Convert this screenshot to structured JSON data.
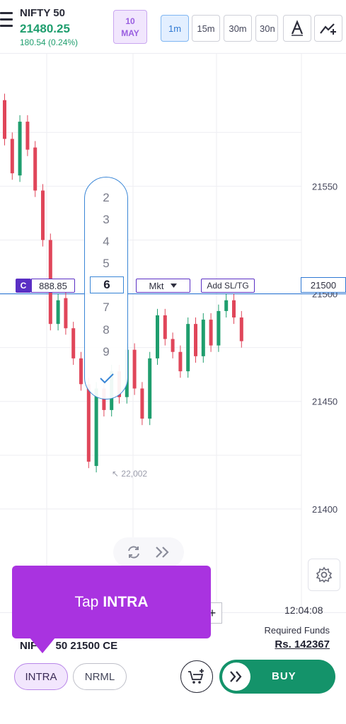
{
  "header": {
    "symbol": "NIFTY 50",
    "ltp": "21480.25",
    "change": "180.54 (0.24%)",
    "expiry_day": "10",
    "expiry_month": "MAY",
    "timeframes": [
      "1m",
      "15m",
      "30m",
      "30n"
    ],
    "active_timeframe": "1m",
    "icons": [
      "menu-icon",
      "text-tool-icon",
      "trend-line-icon"
    ]
  },
  "chart_data": {
    "type": "candlestick",
    "y_ticks": [
      "21550",
      "21500",
      "21450",
      "21400"
    ],
    "ylim": [
      21375,
      21605
    ],
    "price_line": "21500",
    "low_marker": "22,002",
    "candles": [
      {
        "o": 21590,
        "c": 21572
      },
      {
        "o": 21572,
        "c": 21556
      },
      {
        "o": 21555,
        "c": 21580
      },
      {
        "o": 21580,
        "c": 21567
      },
      {
        "o": 21568,
        "c": 21548
      },
      {
        "o": 21548,
        "c": 21525
      },
      {
        "o": 21525,
        "c": 21486
      },
      {
        "o": 21486,
        "c": 21497
      },
      {
        "o": 21498,
        "c": 21484
      },
      {
        "o": 21484,
        "c": 21470
      },
      {
        "o": 21470,
        "c": 21458
      },
      {
        "o": 21458,
        "c": 21422
      },
      {
        "o": 21420,
        "c": 21456
      },
      {
        "o": 21456,
        "c": 21446
      },
      {
        "o": 21446,
        "c": 21464
      },
      {
        "o": 21464,
        "c": 21452
      },
      {
        "o": 21452,
        "c": 21474
      },
      {
        "o": 21474,
        "c": 21456
      },
      {
        "o": 21456,
        "c": 21442
      },
      {
        "o": 21442,
        "c": 21470
      },
      {
        "o": 21470,
        "c": 21490
      },
      {
        "o": 21490,
        "c": 21479
      },
      {
        "o": 21479,
        "c": 21473
      },
      {
        "o": 21473,
        "c": 21464
      },
      {
        "o": 21464,
        "c": 21486
      },
      {
        "o": 21486,
        "c": 21471
      },
      {
        "o": 21471,
        "c": 21488
      },
      {
        "o": 21488,
        "c": 21476
      },
      {
        "o": 21476,
        "c": 21492
      },
      {
        "o": 21492,
        "c": 21497
      },
      {
        "o": 21497,
        "c": 21489
      },
      {
        "o": 21489,
        "c": 21478
      }
    ]
  },
  "order_overlay": {
    "badge": "C",
    "price": "888.85",
    "type": "Mkt",
    "add_sl_tg": "Add SL/TG",
    "picker_items": [
      "2",
      "3",
      "4",
      "5",
      "6",
      "7",
      "8",
      "9"
    ],
    "picker_selected": "6"
  },
  "footer": {
    "time": "12:04:08",
    "contract_prefix": "NIF",
    "contract_suffix": "50 21500 CE",
    "required_funds_label": "Required Funds",
    "required_funds_value": "Rs. 142367",
    "product_types": [
      "INTRA",
      "NRML"
    ],
    "buy_label": "BUY"
  },
  "tooltip": {
    "prefix": "Tap",
    "target": "INTRA"
  },
  "colors": {
    "up": "#1f9e6e",
    "down": "#e0465a",
    "accent": "#a933e0",
    "buy": "#14936a",
    "line": "#2f78d3"
  }
}
